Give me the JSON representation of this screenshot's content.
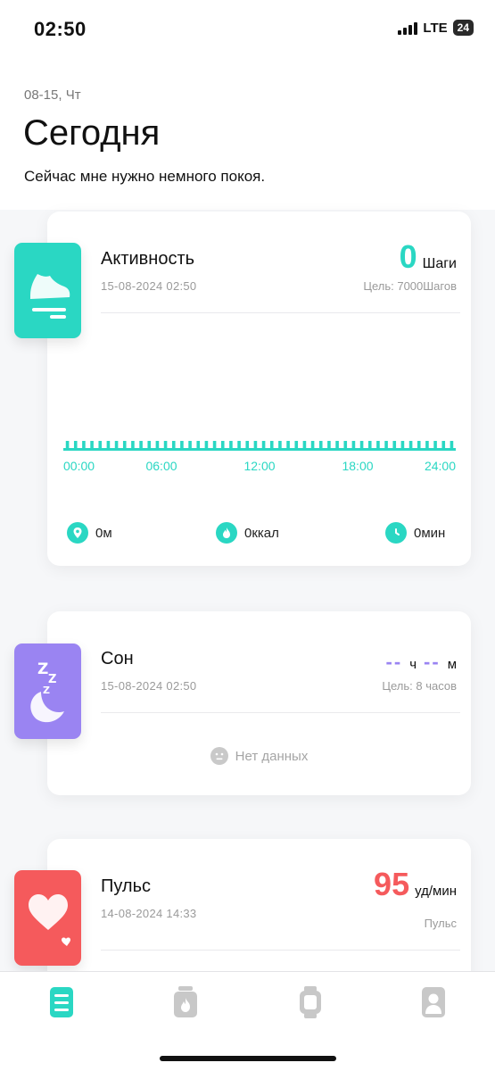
{
  "status_bar": {
    "time": "02:50",
    "network": "LTE",
    "battery": "24"
  },
  "header": {
    "date": "08-15, Чт",
    "title": "Сегодня",
    "subtitle": "Сейчас мне нужно немного покоя."
  },
  "activity": {
    "title": "Активность",
    "timestamp": "15-08-2024 02:50",
    "value": "0",
    "unit": "Шаги",
    "goal": "Цель: 7000Шагов",
    "icon": "sneaker-icon",
    "chart_ticks": [
      "00:00",
      "06:00",
      "12:00",
      "18:00",
      "24:00"
    ],
    "stats": {
      "distance": "0м",
      "calories": "0ккал",
      "duration": "0мин"
    }
  },
  "sleep": {
    "title": "Сон",
    "timestamp": "15-08-2024 02:50",
    "hours_placeholder": "--",
    "hours_unit": "ч",
    "minutes_placeholder": "--",
    "minutes_unit": "м",
    "goal": "Цель:  8 часов",
    "no_data": "Нет данных",
    "icon": "moon-zzz-icon"
  },
  "pulse": {
    "title": "Пульс",
    "timestamp": "14-08-2024 14:33",
    "value": "95",
    "unit": "уд/мин",
    "label": "Пульс",
    "icon": "heart-icon"
  },
  "tabs": [
    {
      "name": "today",
      "icon": "dashboard-icon",
      "active": true
    },
    {
      "name": "workout",
      "icon": "flame-jar-icon",
      "active": false
    },
    {
      "name": "device",
      "icon": "watch-icon",
      "active": false
    },
    {
      "name": "profile",
      "icon": "person-icon",
      "active": false
    }
  ],
  "colors": {
    "activity": "#2ad7c3",
    "sleep": "#9a84f2",
    "pulse": "#f55a5c",
    "tab_inactive": "#c8c8c8"
  }
}
